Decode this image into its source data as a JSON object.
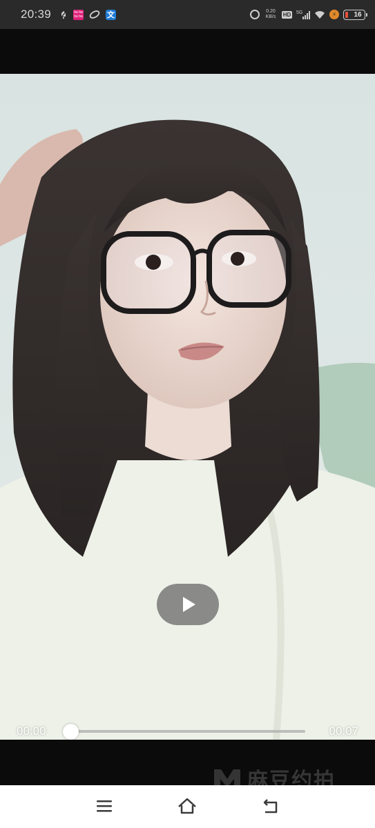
{
  "status_bar": {
    "time": "20:39",
    "notification_icons": [
      "mute-icon",
      "pink-app-icon",
      "leaf-app-icon",
      "translate-app-icon"
    ],
    "pink_app_text": "ba ba ba ba",
    "translate_app_text": "文",
    "net_speed_value": "0.20",
    "net_speed_unit": "KB/s",
    "hd_label": "HD",
    "signal_label": "5G",
    "battery_level": "16",
    "battery_percent": 16,
    "battery_color": "#e0503a",
    "charging_color": "#e08a2a"
  },
  "player": {
    "state": "paused",
    "play_icon": "play-icon",
    "time_current": "00:00",
    "time_total": "00:07",
    "progress": 0.0
  },
  "watermark": {
    "logo_icon": "m-logo-icon",
    "text": "麻豆约拍"
  },
  "nav_bar": {
    "items": [
      "menu-icon",
      "home-icon",
      "back-icon"
    ]
  }
}
